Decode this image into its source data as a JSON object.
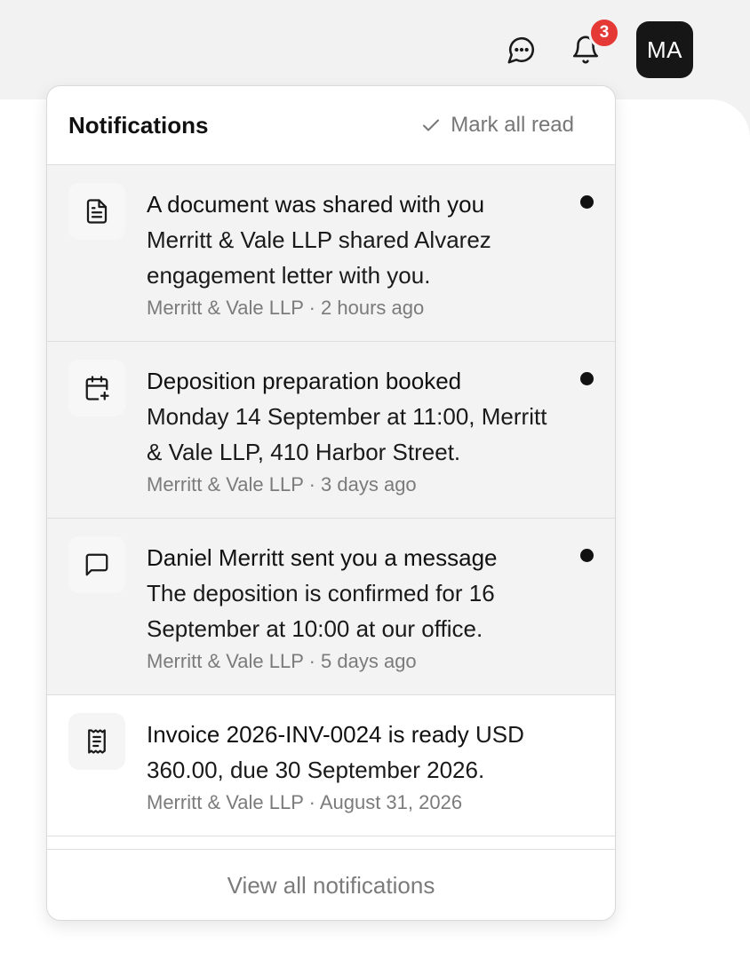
{
  "topbar": {
    "chat_icon": "chat-bubble-icon",
    "bell_icon": "bell-icon",
    "badge_count": "3",
    "avatar_initials": "MA"
  },
  "panel": {
    "title": "Notifications",
    "mark_all_label": "Mark all read",
    "footer_label": "View all notifications"
  },
  "notifications": [
    {
      "icon": "document-icon",
      "title": "A document was shared with you",
      "body": "Merritt & Vale LLP shared Alvarez engagement letter with you.",
      "meta": "Merritt & Vale LLP · 2 hours ago",
      "unread": true
    },
    {
      "icon": "calendar-plus-icon",
      "title": "Deposition preparation booked",
      "body": "Monday 14 September at 11:00, Merritt & Vale LLP, 410 Harbor Street.",
      "meta": "Merritt & Vale LLP · 3 days ago",
      "unread": true
    },
    {
      "icon": "message-icon",
      "title": "Daniel Merritt sent you a message",
      "body": "The deposition is confirmed for 16 September at 10:00 at our office.",
      "meta": "Merritt & Vale LLP · 5 days ago",
      "unread": true
    },
    {
      "icon": "receipt-icon",
      "title": "Invoice 2026-INV-0024 is ready",
      "body": "USD 360.00, due 30 September 2026.",
      "meta": "Merritt & Vale LLP · August 31, 2026",
      "unread": false
    }
  ],
  "colors": {
    "badge": "#e53935",
    "avatar_bg": "#161616",
    "unread_bg": "#f3f3f3",
    "muted_text": "#7b7b7b"
  }
}
